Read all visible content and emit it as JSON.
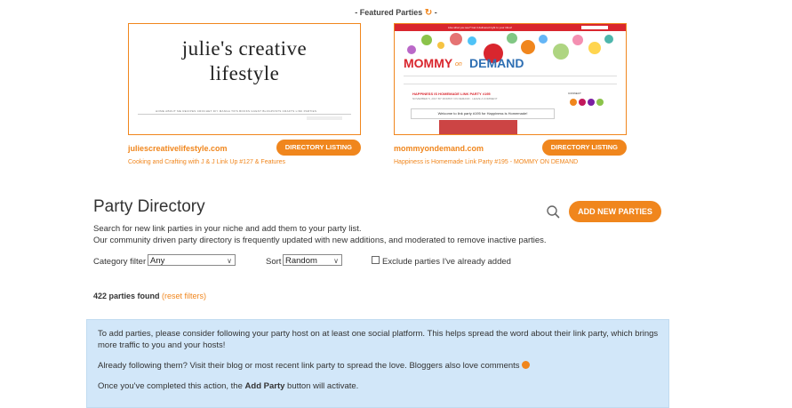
{
  "featured": {
    "header": "- Featured Parties",
    "header_suffix": "-",
    "refresh_icon": "refresh-icon",
    "cards": [
      {
        "thumb_title_line1": "julie's creative",
        "thumb_title_line2": "lifestyle",
        "thumb_nav": "HOME   ABOUT ME   RECIPES   CROCHET   DIY   MANGA TIPS   BOOKS   GUEST BLOGPOSTS   CRAFTS   LINK PARTIES",
        "domain": "juliescreativelifestyle.com",
        "button": "DIRECTORY LISTING",
        "description": "Cooking and Crafting with J & J Link Up #127 & Features"
      },
      {
        "thumb_topbar": "Like what you see? Get it delivered right to your inbox!",
        "thumb_logo1": "MOMMY",
        "thumb_logo_on": "on",
        "thumb_logo2": "DEMAND",
        "thumb_post_title": "HAPPINESS IS HOMEMADE LINK PARTY #195",
        "thumb_post_meta": "NOVEMBER 5, 2017 BY MOMMY ON DEMAND · LEAVE A COMMENT",
        "thumb_welcome": "Welcome to link party #195 for Happiness is Homemade!",
        "thumb_connect": "CONNECT",
        "domain": "mommyondemand.com",
        "button": "DIRECTORY LISTING",
        "description": "Happiness is Homemade Link Party #195 - MOMMY ON DEMAND"
      }
    ]
  },
  "directory": {
    "title": "Party Directory",
    "add_button": "ADD NEW PARTIES",
    "desc_line1": "Search for new link parties in your niche and add them to your party list.",
    "desc_line2": "Our community driven party directory is frequently updated with new additions, and moderated to remove inactive parties.",
    "category_label": "Category filter",
    "category_value": "Any",
    "sort_label": "Sort",
    "sort_value": "Random",
    "exclude_label": "Exclude parties I've already added",
    "found_count": "422 parties found",
    "reset_link": "(reset filters)"
  },
  "notice": {
    "para1": "To add parties, please consider following your party host on at least one social platform. This helps spread the word about their link party, which brings more traffic to you and your hosts!",
    "para2": "Already following them? Visit their blog or most recent link party to spread the love. Bloggers also love comments",
    "para3_prefix": "Once you've completed this action, the",
    "para3_bold": "Add Party",
    "para3_suffix": "button will activate."
  },
  "colors": {
    "accent": "#f0861d",
    "notice_bg": "#d2e7f9"
  }
}
